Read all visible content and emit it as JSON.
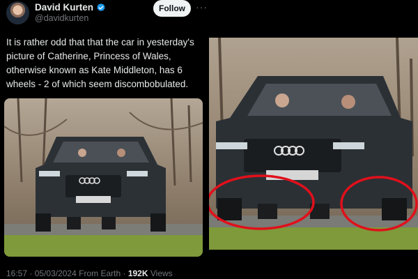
{
  "author": {
    "name": "David Kurten",
    "handle": "@davidkurten",
    "verified_icon": "verified-badge-icon",
    "badge_color": "#1d9bf0"
  },
  "actions": {
    "follow_label": "Follow",
    "more_label": "···"
  },
  "tweet": {
    "text": "It is rather odd that that the car in yesterday's picture of Catherine, Princess of Wales, otherwise known as Kate Middleton, has 6 wheels - 2 of which seem discombobulated."
  },
  "meta": {
    "time": "16:57",
    "date": "05/03/2024",
    "source": "From Earth",
    "separator": "·",
    "views_count": "192K",
    "views_label": "Views"
  },
  "colors": {
    "background": "#000000",
    "text_primary": "#e7e9ea",
    "text_secondary": "#71767b",
    "circle_annotation": "#e0101b"
  }
}
